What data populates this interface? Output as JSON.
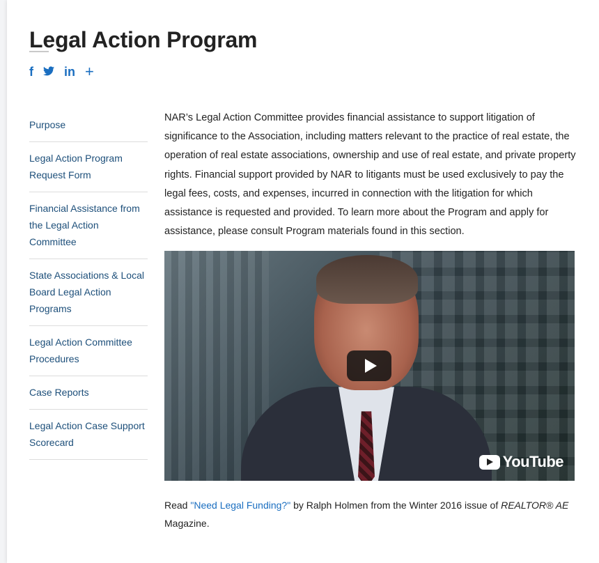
{
  "page": {
    "title": "Legal Action Program"
  },
  "social": {
    "facebook": "f",
    "twitter": "🐦",
    "linkedin": "in",
    "more": "+"
  },
  "sidebar": {
    "items": [
      {
        "label": "Purpose"
      },
      {
        "label": "Legal Action Program Request Form"
      },
      {
        "label": "Financial Assistance from the Legal Action Committee"
      },
      {
        "label": "State Associations & Local Board Legal Action Programs"
      },
      {
        "label": "Legal Action Committee Procedures"
      },
      {
        "label": "Case Reports"
      },
      {
        "label": "Legal Action Case Support Scorecard"
      }
    ]
  },
  "main": {
    "intro": "NAR’s Legal Action Committee provides financial assistance to support litigation of significance to the Association, including matters relevant to the practice of real estate, the operation of real estate associations, ownership and use of real estate, and private property rights. Financial support provided by NAR to litigants must be used exclusively to pay the legal fees, costs, and expenses, incurred in connection with the litigation for which assistance is requested and provided. To learn more about the Program and apply for assistance, please consult Program materials found in this section.",
    "video": {
      "brand": "YouTube"
    },
    "read": {
      "prefix": "Read ",
      "link": "\"Need Legal Funding?\"",
      "middle": " by Ralph Holmen from the Winter 2016 issue of ",
      "publication": "REALTOR® AE",
      "suffix": " Magazine."
    }
  },
  "colors": {
    "link": "#1a6ec0",
    "nav_text": "#1d4f7a",
    "divider": "#dcdcdc"
  }
}
